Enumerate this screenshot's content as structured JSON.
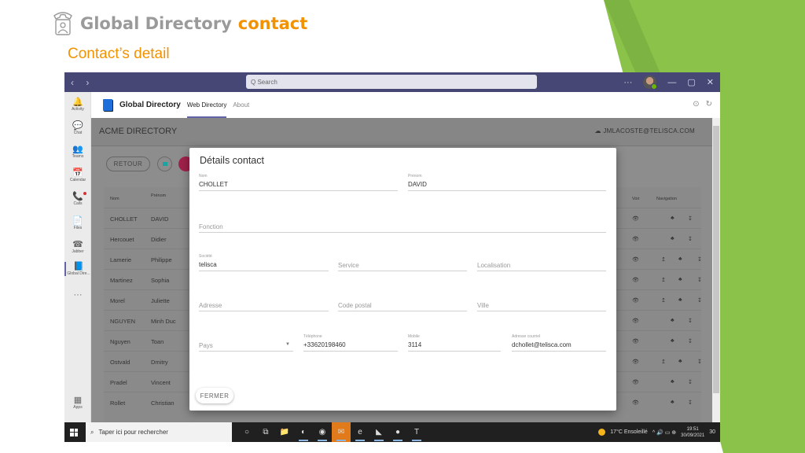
{
  "slide": {
    "title_part1": "Global Directory",
    "title_part2": "contact",
    "subtitle": "Contact’s detail",
    "accent_color": "#f39200",
    "green_color": "#8bc34a"
  },
  "teams": {
    "nav_arrows": "‹ ›",
    "search_placeholder": "Q  Search",
    "more": "···",
    "minimize": "—",
    "maximize": "▢",
    "close": "✕",
    "rail": [
      {
        "icon": "🔔",
        "label": "Activity"
      },
      {
        "icon": "💬",
        "label": "Chat"
      },
      {
        "icon": "👥",
        "label": "Teams"
      },
      {
        "icon": "📅",
        "label": "Calendar"
      },
      {
        "icon": "📞",
        "label": "Calls"
      },
      {
        "icon": "📄",
        "label": "Files"
      },
      {
        "icon": "☎",
        "label": "Jabber"
      },
      {
        "icon": "📘",
        "label": "Global Dire..."
      },
      {
        "icon": "···",
        "label": ""
      },
      {
        "icon": "▦",
        "label": "Apps"
      }
    ],
    "app_name": "Global Directory",
    "tabs": [
      "Web Directory",
      "About"
    ],
    "popout_icon": "⊙",
    "refresh_icon": "↻"
  },
  "directory": {
    "title": "ACME DIRECTORY",
    "user": "☁ JMLACOSTE@TELISCA.COM",
    "retour_label": "RETOUR",
    "columns": {
      "nom": "Nom",
      "prenom": "Prénom",
      "voir": "Voir",
      "navigation": "Navigation"
    },
    "rows": [
      {
        "nom": "CHOLLET",
        "prenom": "DAVID",
        "up": false
      },
      {
        "nom": "Hercouet",
        "prenom": "Didier",
        "up": false
      },
      {
        "nom": "Lamerie",
        "prenom": "Philippe",
        "up": true
      },
      {
        "nom": "Martinez",
        "prenom": "Sophia",
        "up": true
      },
      {
        "nom": "Morel",
        "prenom": "Juliette",
        "up": true
      },
      {
        "nom": "NGUYEN",
        "prenom": "Minh Duc",
        "up": false
      },
      {
        "nom": "Nguyen",
        "prenom": "Toan",
        "up": false
      },
      {
        "nom": "Ostvald",
        "prenom": "Dmitry",
        "up": true
      },
      {
        "nom": "Pradel",
        "prenom": "Vincent",
        "up": false
      },
      {
        "nom": "Rollet",
        "prenom": "Christian",
        "up": false
      }
    ],
    "eye_icon": "👁",
    "up_icon": "↥",
    "org_icon": "♣",
    "down_icon": "↧"
  },
  "modal": {
    "title": "Détails contact",
    "fields": {
      "nom": {
        "label": "Nom",
        "value": "CHOLLET"
      },
      "prenom": {
        "label": "Prénom",
        "value": "DAVID"
      },
      "fonction": {
        "placeholder": "Fonction"
      },
      "societe": {
        "label": "Société",
        "value": "telisca"
      },
      "service": {
        "placeholder": "Service"
      },
      "localisation": {
        "placeholder": "Localisation"
      },
      "adresse": {
        "placeholder": "Adresse"
      },
      "code_postal": {
        "placeholder": "Code postal"
      },
      "ville": {
        "placeholder": "Ville"
      },
      "pays": {
        "placeholder": "Pays"
      },
      "telephone": {
        "label": "Téléphone",
        "value": "+33620198460"
      },
      "mobile": {
        "label": "Mobile",
        "value": "3114"
      },
      "email": {
        "label": "Adresse courriel",
        "value": "dchollet@telisca.com"
      }
    },
    "close_label": "FERMER"
  },
  "taskbar": {
    "search_placeholder": "Taper ici pour rechercher",
    "apps": [
      {
        "icon": "○",
        "name": "cortana"
      },
      {
        "icon": "⧉",
        "name": "task-view"
      },
      {
        "icon": "📁",
        "name": "explorer"
      },
      {
        "icon": "◐",
        "name": "teams-classic"
      },
      {
        "icon": "◉",
        "name": "webex"
      },
      {
        "icon": "✉",
        "name": "outlook"
      },
      {
        "icon": "e",
        "name": "edge"
      },
      {
        "icon": "◣",
        "name": "visual-studio"
      },
      {
        "icon": "●",
        "name": "powerpoint"
      },
      {
        "icon": "T",
        "name": "teams"
      }
    ],
    "weather": "17°C  Ensoleillé",
    "tray_icons": "^  🔊  ▭  ⊕",
    "time": "19:51",
    "date": "30/09/2021",
    "notifications": "30"
  }
}
